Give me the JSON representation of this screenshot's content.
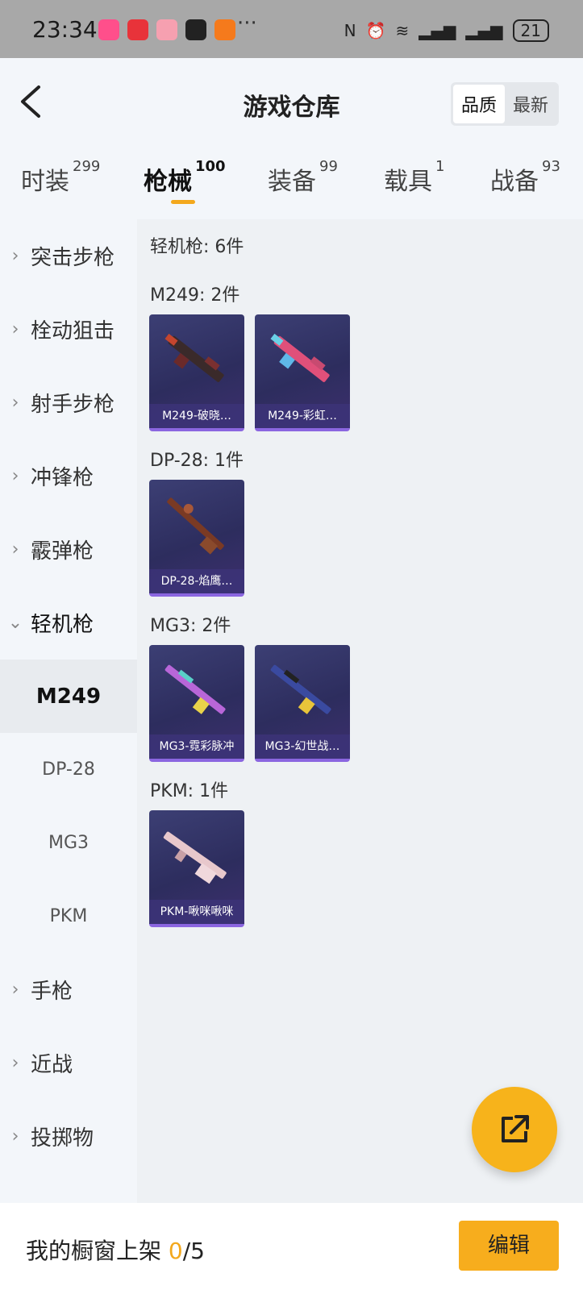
{
  "status_bar": {
    "time": "23:34",
    "battery": "21",
    "more": "···"
  },
  "header": {
    "title": "游戏仓库",
    "sort_options": [
      "品质",
      "最新"
    ],
    "tabs": [
      {
        "label": "时装",
        "count": "299"
      },
      {
        "label": "枪械",
        "count": "100"
      },
      {
        "label": "装备",
        "count": "99"
      },
      {
        "label": "载具",
        "count": "1"
      },
      {
        "label": "战备",
        "count": "93"
      }
    ]
  },
  "sidebar": {
    "items": [
      "突击步枪",
      "栓动狙击",
      "射手步枪",
      "冲锋枪",
      "霰弹枪",
      "轻机枪"
    ],
    "sub_items": [
      "M249",
      "DP-28",
      "MG3",
      "PKM"
    ],
    "items_after": [
      "手枪",
      "近战",
      "投掷物"
    ],
    "chevron_right": "›",
    "chevron_down": "⌄"
  },
  "content": {
    "section_title": "轻机枪: 6件",
    "groups": [
      {
        "title": "M249: 2件",
        "items": [
          "M249-破晓…",
          "M249-彩虹…"
        ]
      },
      {
        "title": "DP-28: 1件",
        "items": [
          "DP-28-焰鹰…"
        ]
      },
      {
        "title": "MG3: 2件",
        "items": [
          "MG3-霓彩脉冲",
          "MG3-幻世战…"
        ]
      },
      {
        "title": "PKM: 1件",
        "items": [
          "PKM-啾咪啾咪"
        ]
      }
    ]
  },
  "bottom_bar": {
    "label": "我的橱窗上架 ",
    "current": "0",
    "total": "/5",
    "edit": "编辑"
  },
  "colors": {
    "accent": "#f7b31b",
    "card_bg": "#2d2d5e",
    "card_border": "#8b66e0"
  }
}
